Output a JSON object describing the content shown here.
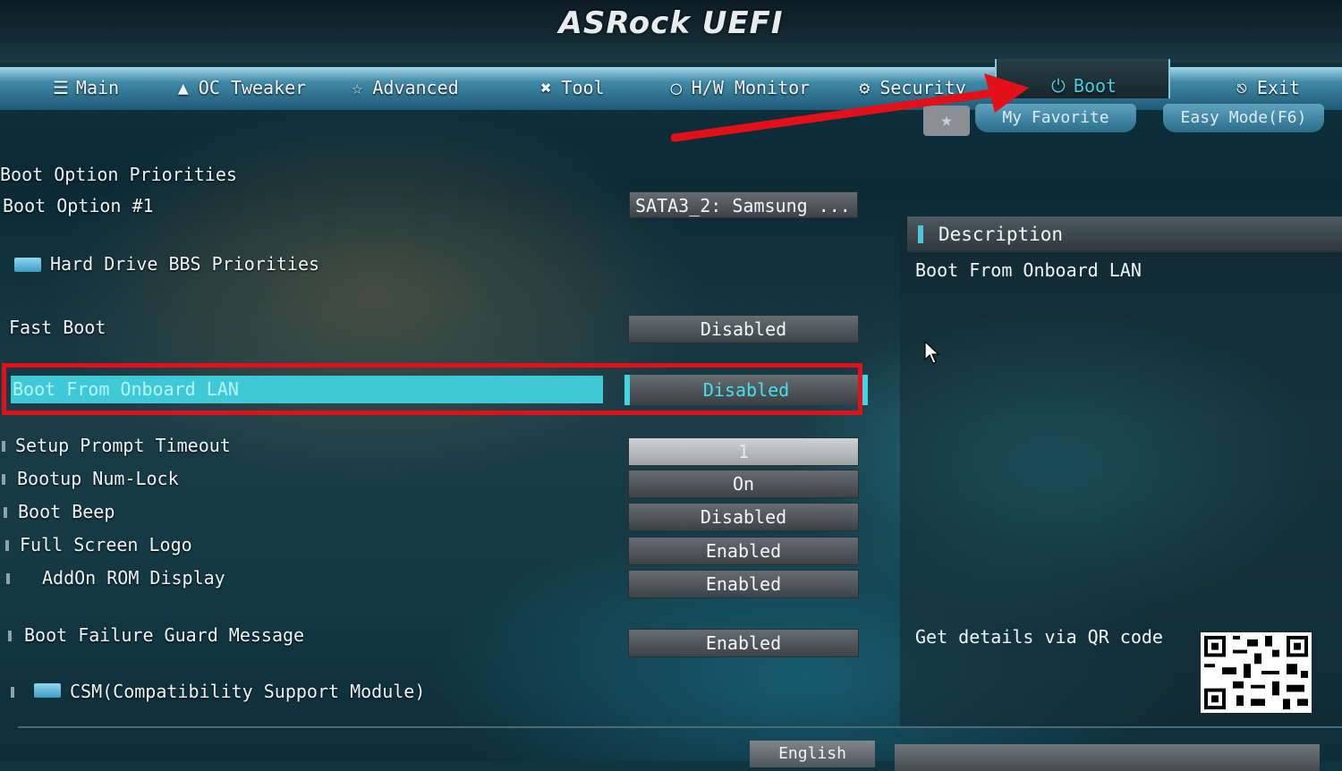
{
  "header": {
    "logo_text": "ASRock UEFI"
  },
  "tabs": [
    {
      "label": "Main",
      "icon": "list-icon"
    },
    {
      "label": "OC Tweaker",
      "icon": "rocket-icon"
    },
    {
      "label": "Advanced",
      "icon": "star-icon"
    },
    {
      "label": "Tool",
      "icon": "tools-icon"
    },
    {
      "label": "H/W Monitor",
      "icon": "monitor-gauge-icon"
    },
    {
      "label": "Security",
      "icon": "shield-icon"
    },
    {
      "label": "Boot",
      "icon": "power-icon",
      "active": true
    },
    {
      "label": "Exit",
      "icon": "exit-door-icon"
    }
  ],
  "sub_buttons": {
    "favorite": "My Favorite",
    "easy_mode": "Easy Mode(F6)"
  },
  "section_title": "Boot Option Priorities",
  "settings": {
    "boot_option_1": {
      "label": "Boot Option #1",
      "value": "SATA3_2: Samsung ..."
    },
    "hdd_bbs": {
      "label": "Hard Drive BBS Priorities"
    },
    "fast_boot": {
      "label": "Fast Boot",
      "value": "Disabled"
    },
    "boot_from_lan": {
      "label": "Boot From Onboard LAN",
      "value": "Disabled"
    },
    "setup_prompt": {
      "label": "Setup Prompt Timeout",
      "value": "1"
    },
    "num_lock": {
      "label": "Bootup Num-Lock",
      "value": "On"
    },
    "boot_beep": {
      "label": "Boot Beep",
      "value": "Disabled"
    },
    "full_screen_logo": {
      "label": "Full Screen Logo",
      "value": "Enabled"
    },
    "addon_rom": {
      "label": "AddOn ROM Display",
      "value": "Enabled"
    },
    "failure_guard": {
      "label": "Boot Failure Guard Message",
      "value": "Enabled"
    },
    "csm": {
      "label": "CSM(Compatibility Support Module)"
    }
  },
  "description": {
    "title": "Description",
    "text": "Boot From Onboard LAN",
    "qr_label": "Get details via QR code"
  },
  "footer": {
    "language": "English"
  },
  "colors": {
    "highlight": "#3fc9d6",
    "annotation_red": "#e3101a",
    "active_tab_text": "#3fd3e8"
  }
}
